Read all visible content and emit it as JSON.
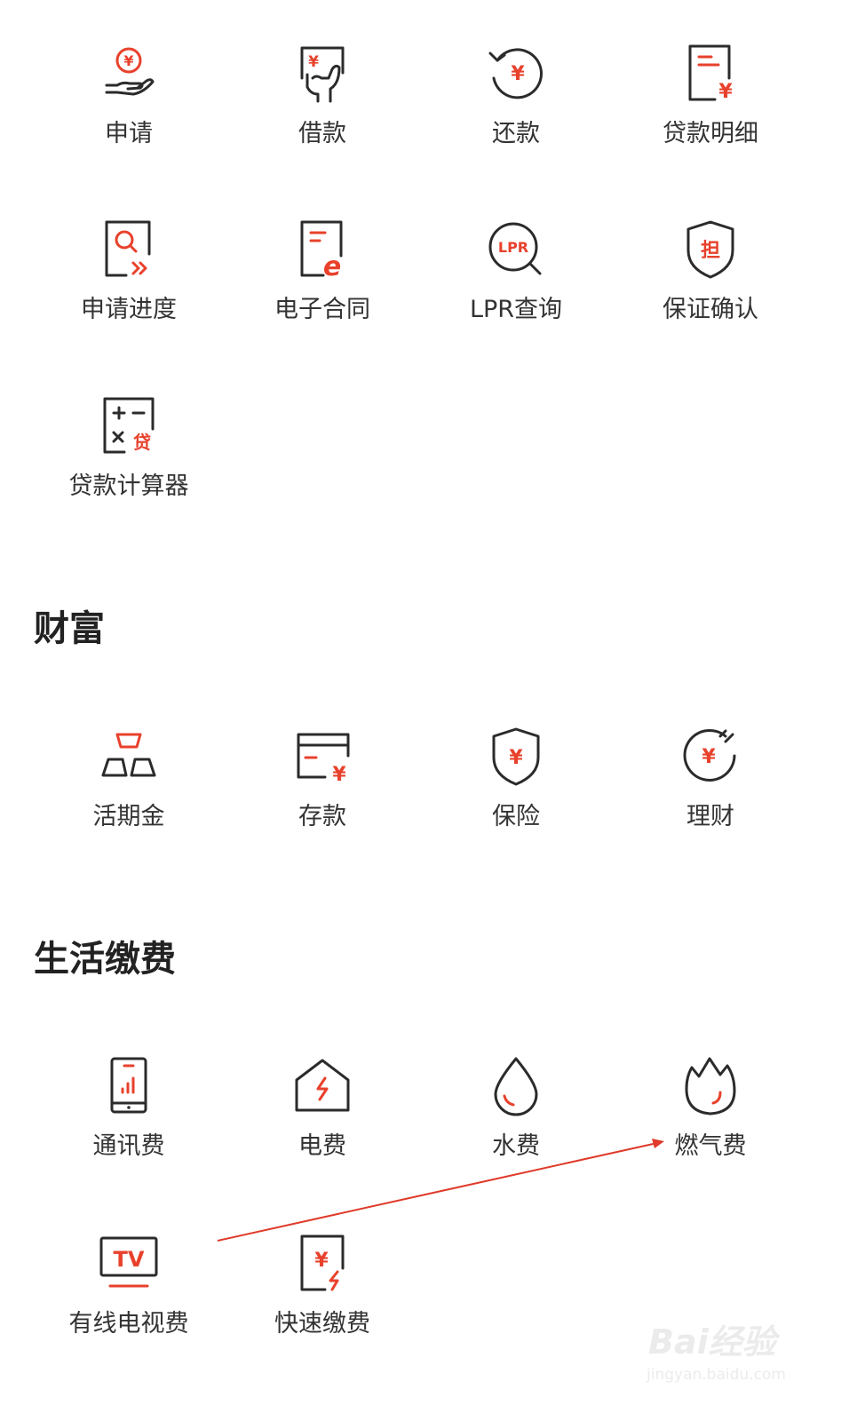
{
  "loan": {
    "items": [
      {
        "label": "申请",
        "icon": "yuan-coin-hand-icon"
      },
      {
        "label": "借款",
        "icon": "card-hand-yuan-icon"
      },
      {
        "label": "还款",
        "icon": "yuan-refresh-icon"
      },
      {
        "label": "贷款明细",
        "icon": "document-yuan-icon"
      },
      {
        "label": "申请进度",
        "icon": "document-search-icon"
      },
      {
        "label": "电子合同",
        "icon": "document-e-icon"
      },
      {
        "label": "LPR查询",
        "icon": "lpr-magnifier-icon"
      },
      {
        "label": "保证确认",
        "icon": "shield-guarantee-icon"
      },
      {
        "label": "贷款计算器",
        "icon": "calculator-icon"
      }
    ]
  },
  "wealth": {
    "title": "财富",
    "items": [
      {
        "label": "活期金",
        "icon": "gold-bars-icon"
      },
      {
        "label": "存款",
        "icon": "bank-card-yuan-icon"
      },
      {
        "label": "保险",
        "icon": "shield-yuan-icon"
      },
      {
        "label": "理财",
        "icon": "yuan-growth-circle-icon"
      }
    ]
  },
  "bills": {
    "title": "生活缴费",
    "items": [
      {
        "label": "通讯费",
        "icon": "mobile-signal-icon"
      },
      {
        "label": "电费",
        "icon": "house-lightning-icon"
      },
      {
        "label": "水费",
        "icon": "water-drop-icon"
      },
      {
        "label": "燃气费",
        "icon": "flame-icon"
      },
      {
        "label": "有线电视费",
        "icon": "tv-icon"
      },
      {
        "label": "快速缴费",
        "icon": "document-yuan-bolt-icon"
      }
    ]
  },
  "icon_glyphs": {
    "yuan": "¥",
    "lpr": "LPR",
    "guarantee": "担",
    "loan_char": "贷",
    "tv": "TV",
    "e": "e"
  },
  "watermark": {
    "brand": "Bai经验",
    "url": "jingyan.baidu.com"
  },
  "colors": {
    "accent": "#e8412c",
    "icon_stroke": "#2b2b2b",
    "text": "#333333",
    "annotation_arrow": "#e03a2a"
  }
}
